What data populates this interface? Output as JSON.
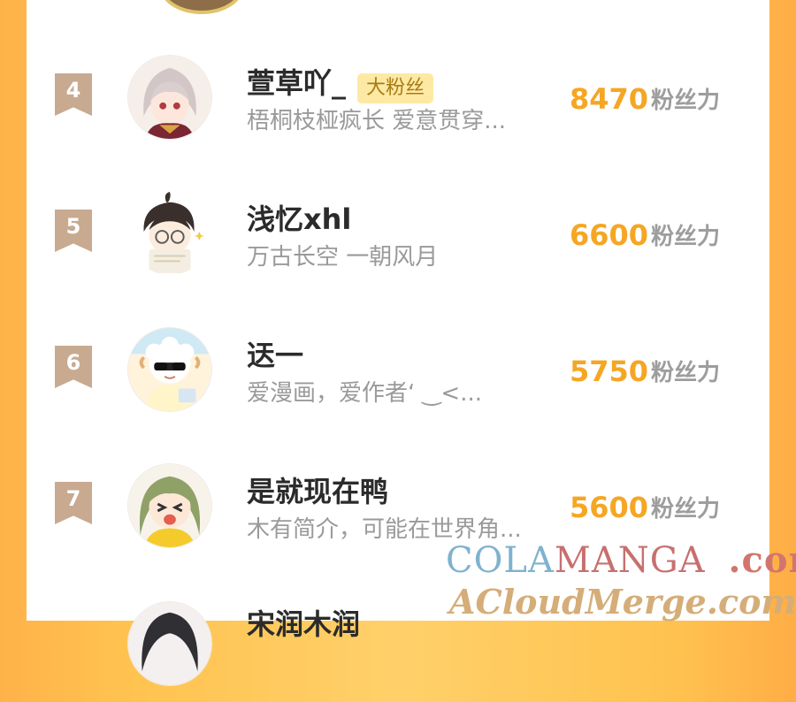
{
  "ranking": {
    "score_unit": "粉丝力",
    "rows": [
      {
        "rank": "4",
        "name": "萱草吖_",
        "badge": "大粉丝",
        "bio": "梧桐枝桠疯长 爱意贯穿...",
        "score": "8470"
      },
      {
        "rank": "5",
        "name": "浅忆xhl",
        "bio": "万古长空 一朝风月",
        "score": "6600"
      },
      {
        "rank": "6",
        "name": "迗一",
        "bio": "爱漫画，爱作者‘ ‿<...",
        "score": "5750"
      },
      {
        "rank": "7",
        "name": "是就现在鸭",
        "bio": "木有简介，可能在世界角...",
        "score": "5600"
      },
      {
        "name": "宋润木润"
      }
    ]
  },
  "watermark": {
    "line1_part1": "COLA",
    "line1_part2": "MANGA",
    "line1_part3": ".com",
    "line2": "ACloudMerge.com"
  },
  "colors": {
    "rank_badge": "#c8aa91",
    "score": "#f5a623",
    "background_orange": "#ffc24f"
  }
}
